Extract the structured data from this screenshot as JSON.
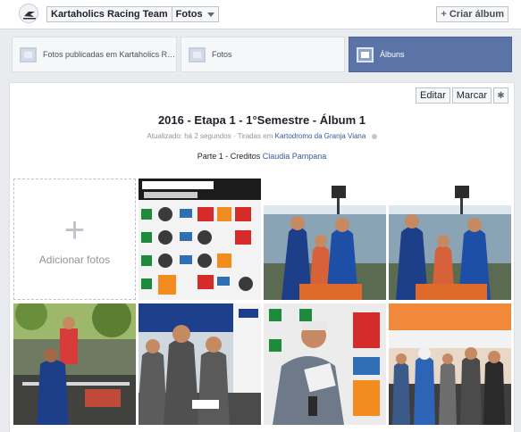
{
  "topbar": {
    "page_name": "Kartaholics Racing Team",
    "section": "Fotos",
    "create_album": "Criar álbum"
  },
  "tabs": [
    {
      "label": "Fotos publicadas em Kartaholics Racin...",
      "active": false
    },
    {
      "label": "Fotos",
      "active": false
    },
    {
      "label": "Álbuns",
      "active": true
    }
  ],
  "album": {
    "actions": {
      "edit": "Editar",
      "tag": "Marcar",
      "settings_icon": "gear-icon"
    },
    "title": "2016 - Etapa 1 - 1°Semestre - Álbum 1",
    "updated": "Atualizado: há 2 segundos",
    "taken_prefix": "Tiradas em",
    "location": "Kartodromo da Granja Viana",
    "description_prefix": "Parte 1 - Creditos",
    "photographer": "Claudia Pampana"
  },
  "add_photos": "Adicionar fotos",
  "colors": {
    "active_tab": "#5b74a8",
    "link": "#365899"
  },
  "photos": [
    {
      "name": "sponsor-banner-photo",
      "desc": "Kartaholics sponsor wall"
    },
    {
      "name": "podium-photo-1"
    },
    {
      "name": "podium-photo-2"
    },
    {
      "name": "track-photo"
    },
    {
      "name": "team-group-photo"
    },
    {
      "name": "signing-photo"
    },
    {
      "name": "crowd-photo"
    }
  ]
}
